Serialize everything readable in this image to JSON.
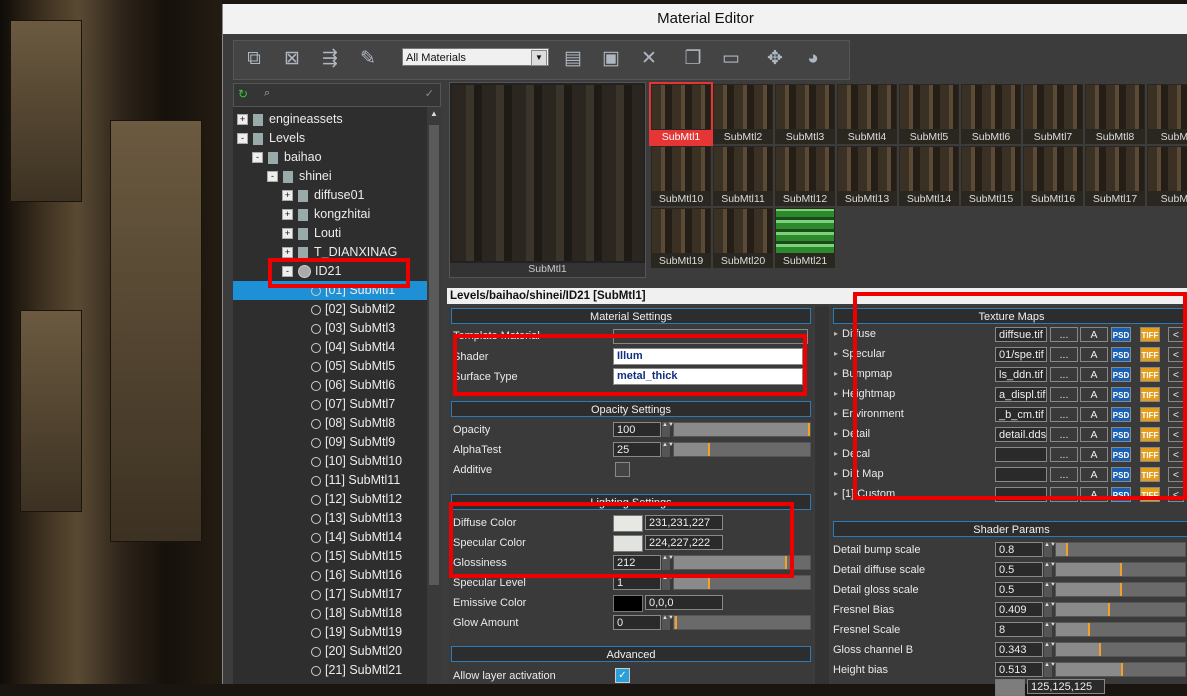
{
  "window": {
    "title": "Material Editor"
  },
  "toolbar": {
    "filter_selected": "All Materials",
    "icons": [
      "get-from-selected-icon",
      "remove-icon",
      "assign-icon",
      "pick-icon",
      "save-icon",
      "delete-icon",
      "copy-icon",
      "paste-icon",
      "preview-icon",
      "sphere-icon"
    ]
  },
  "tree": {
    "items": [
      {
        "label": "engineassets",
        "level": 0,
        "type": "folder",
        "expand": "+"
      },
      {
        "label": "Levels",
        "level": 0,
        "type": "folder",
        "expand": "-"
      },
      {
        "label": "baihao",
        "level": 1,
        "type": "folder",
        "expand": "-"
      },
      {
        "label": "shinei",
        "level": 2,
        "type": "folder",
        "expand": "-"
      },
      {
        "label": "diffuse01",
        "level": 3,
        "type": "folder",
        "expand": "+"
      },
      {
        "label": "kongzhitai",
        "level": 3,
        "type": "folder",
        "expand": "+"
      },
      {
        "label": "Louti",
        "level": 3,
        "type": "folder",
        "expand": "+"
      },
      {
        "label": "T_DIANXINAG",
        "level": 3,
        "type": "folder",
        "expand": "+"
      },
      {
        "label": "ID21",
        "level": 3,
        "type": "material",
        "expand": "-"
      },
      {
        "label": "[01] SubMtl1",
        "level": 4,
        "type": "sub",
        "selected": true
      },
      {
        "label": "[02] SubMtl2",
        "level": 4,
        "type": "sub"
      },
      {
        "label": "[03] SubMtl3",
        "level": 4,
        "type": "sub"
      },
      {
        "label": "[04] SubMtl4",
        "level": 4,
        "type": "sub"
      },
      {
        "label": "[05] SubMtl5",
        "level": 4,
        "type": "sub"
      },
      {
        "label": "[06] SubMtl6",
        "level": 4,
        "type": "sub"
      },
      {
        "label": "[07] SubMtl7",
        "level": 4,
        "type": "sub"
      },
      {
        "label": "[08] SubMtl8",
        "level": 4,
        "type": "sub"
      },
      {
        "label": "[09] SubMtl9",
        "level": 4,
        "type": "sub"
      },
      {
        "label": "[10] SubMtl10",
        "level": 4,
        "type": "sub"
      },
      {
        "label": "[11] SubMtl11",
        "level": 4,
        "type": "sub"
      },
      {
        "label": "[12] SubMtl12",
        "level": 4,
        "type": "sub"
      },
      {
        "label": "[13] SubMtl13",
        "level": 4,
        "type": "sub"
      },
      {
        "label": "[14] SubMtl14",
        "level": 4,
        "type": "sub"
      },
      {
        "label": "[15] SubMtl15",
        "level": 4,
        "type": "sub"
      },
      {
        "label": "[16] SubMtl16",
        "level": 4,
        "type": "sub"
      },
      {
        "label": "[17] SubMtl17",
        "level": 4,
        "type": "sub"
      },
      {
        "label": "[18] SubMtl18",
        "level": 4,
        "type": "sub"
      },
      {
        "label": "[19] SubMtl19",
        "level": 4,
        "type": "sub"
      },
      {
        "label": "[20] SubMtl20",
        "level": 4,
        "type": "sub"
      },
      {
        "label": "[21] SubMtl21",
        "level": 4,
        "type": "sub"
      }
    ]
  },
  "preview": {
    "caption": "SubMtl1"
  },
  "thumbnails": [
    "SubMtl1",
    "SubMtl2",
    "SubMtl3",
    "SubMtl4",
    "SubMtl5",
    "SubMtl6",
    "SubMtl7",
    "SubMtl8",
    "SubMtl",
    "SubMtl10",
    "SubMtl11",
    "SubMtl12",
    "SubMtl13",
    "SubMtl14",
    "SubMtl15",
    "SubMtl16",
    "SubMtl17",
    "SubMtl",
    "SubMtl19",
    "SubMtl20",
    "SubMtl21"
  ],
  "path": "Levels/baihao/shinei/ID21 [SubMtl1]",
  "material_settings": {
    "title": "Material Settings",
    "template_label": "Template Material",
    "shader_label": "Shader",
    "shader_value": "Illum",
    "surface_label": "Surface Type",
    "surface_value": "metal_thick"
  },
  "opacity_settings": {
    "title": "Opacity Settings",
    "opacity_label": "Opacity",
    "opacity_value": "100",
    "opacity_fraction": 1.0,
    "alphatest_label": "AlphaTest",
    "alphatest_value": "25",
    "alphatest_fraction": 0.25,
    "additive_label": "Additive"
  },
  "lighting_settings": {
    "title": "Lighting Settings",
    "diffuse_label": "Diffuse Color",
    "diffuse_value": "231,231,227",
    "diffuse_hex": "#e7e7e3",
    "specular_label": "Specular Color",
    "specular_value": "224,227,222",
    "specular_hex": "#e0e3de",
    "gloss_label": "Glossiness",
    "gloss_value": "212",
    "gloss_fraction": 0.83,
    "speclevel_label": "Specular Level",
    "speclevel_value": "1",
    "speclevel_fraction": 0.25,
    "emissive_label": "Emissive Color",
    "emissive_value": "0,0,0",
    "emissive_hex": "#000000",
    "glow_label": "Glow Amount",
    "glow_value": "0",
    "glow_fraction": 0.0
  },
  "advanced": {
    "title": "Advanced",
    "layer_label": "Allow layer activation"
  },
  "texture_maps": {
    "title": "Texture Maps",
    "rows": [
      {
        "label": "Diffuse",
        "file": "diffsue.tif"
      },
      {
        "label": "Specular",
        "file": "01/spe.tif"
      },
      {
        "label": "Bumpmap",
        "file": "ls_ddn.tif"
      },
      {
        "label": "Heightmap",
        "file": "a_displ.tif"
      },
      {
        "label": "Environment",
        "file": "_b_cm.tif"
      },
      {
        "label": "Detail",
        "file": "detail.dds"
      },
      {
        "label": "Decal",
        "file": ""
      },
      {
        "label": "Dirt Map",
        "file": ""
      },
      {
        "label": "[1] Custom",
        "file": ""
      }
    ],
    "button_dots": "...",
    "button_a": "A",
    "button_psd": "PSD",
    "button_tiff": "TIFF",
    "button_arrow": "<"
  },
  "shader_params": {
    "title": "Shader Params",
    "rows": [
      {
        "label": "Detail bump scale",
        "value": "0.8",
        "fraction": 0.08
      },
      {
        "label": "Detail diffuse scale",
        "value": "0.5",
        "fraction": 0.5
      },
      {
        "label": "Detail gloss scale",
        "value": "0.5",
        "fraction": 0.5
      },
      {
        "label": "Fresnel Bias",
        "value": "0.409",
        "fraction": 0.41
      },
      {
        "label": "Fresnel Scale",
        "value": "8",
        "fraction": 0.25
      },
      {
        "label": "Gloss channel B",
        "value": "0.343",
        "fraction": 0.34
      },
      {
        "label": "Height bias",
        "value": "0.513",
        "fraction": 0.51
      }
    ],
    "partial_value": "125,125,125"
  },
  "colors": {
    "accent": "#1e90d6",
    "highlight": "#e00000",
    "slider_mark": "#f2a22a"
  }
}
